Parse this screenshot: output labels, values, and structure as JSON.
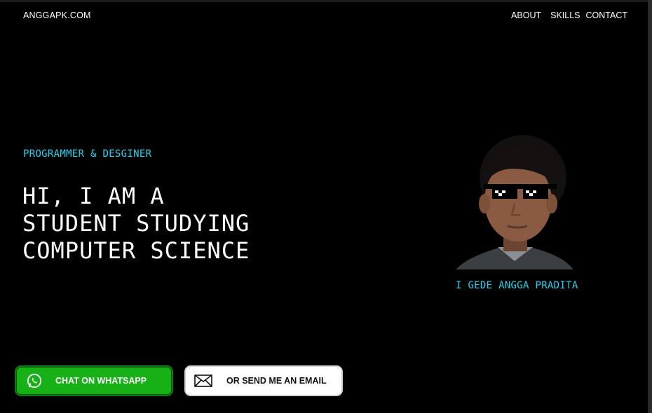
{
  "header": {
    "logo": "ANGGAPK.COM",
    "nav": [
      "ABOUT",
      "SKILLS",
      "CONTACT"
    ]
  },
  "hero": {
    "subtitle": "PROGRAMMER & DESGINER",
    "headline": "HI, I AM A\nSTUDENT STUDYING\nCOMPUTER SCIENCE",
    "name": "I GEDE ANGGA PRADITA"
  },
  "buttons": {
    "whatsapp_label": "CHAT ON WHATSAPP",
    "email_label": "OR SEND ME AN EMAIL"
  },
  "icons": {
    "whatsapp": "whatsapp-icon",
    "email": "envelope-icon"
  },
  "colors": {
    "accent": "#22d3ee",
    "whatsapp_green": "#17b117",
    "background": "#000000"
  }
}
